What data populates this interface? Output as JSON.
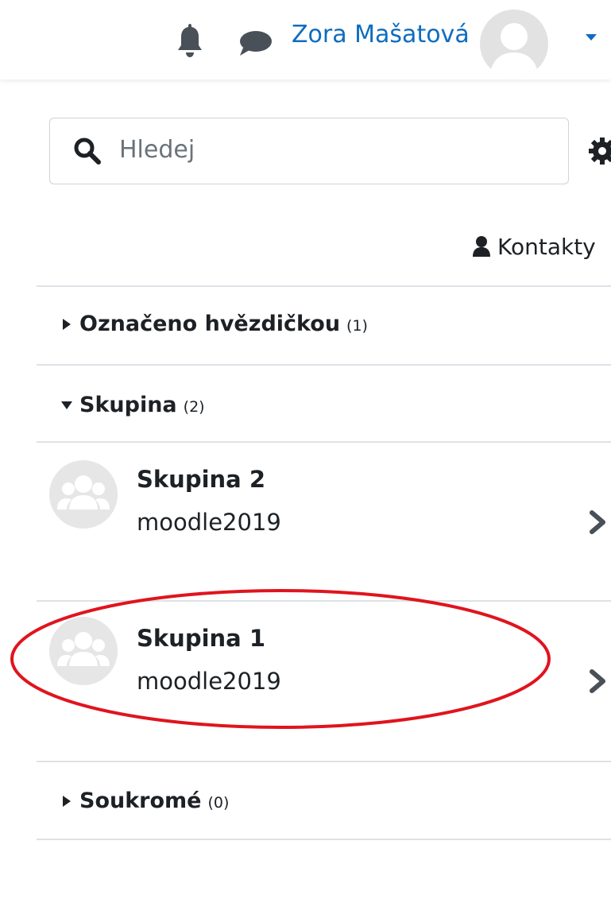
{
  "navbar": {
    "user_name": "Zora Mašatová",
    "icons": [
      "bell-icon",
      "chat-icon",
      "user-avatar",
      "caret-down-icon"
    ]
  },
  "drawer": {
    "search": {
      "placeholder": "Hledej",
      "value": ""
    },
    "contacts_label": "Kontakty",
    "sections": [
      {
        "title": "Označeno hvězdičkou",
        "count": "(1)",
        "expanded": false
      },
      {
        "title": "Skupina",
        "count": "(2)",
        "expanded": true
      },
      {
        "title": "Soukromé",
        "count": "(0)",
        "expanded": false
      }
    ],
    "conversations": [
      {
        "name": "Skupina 2",
        "subtitle": "moodle2019"
      },
      {
        "name": "Skupina 1",
        "subtitle": "moodle2019",
        "highlighted": true
      }
    ]
  },
  "colors": {
    "link": "#0f6cbf",
    "text": "#1d2125",
    "muted": "#6a737b",
    "divider": "#dee2e6",
    "highlight": "#e0141e",
    "avatar_bg": "#e6e6e6"
  }
}
